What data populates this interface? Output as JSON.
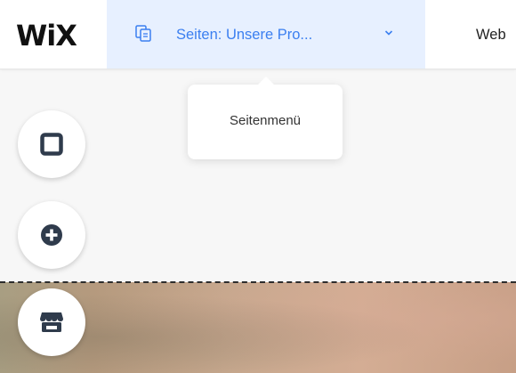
{
  "header": {
    "logo": "WiX",
    "pages_dropdown": {
      "label": "Seiten: Unsere Pro...",
      "icon": "pages-icon"
    },
    "website_label": "Web"
  },
  "tooltip": {
    "text": "Seitenmenü"
  },
  "toolbar": {
    "buttons": [
      {
        "name": "add-section-button",
        "icon": "square-icon"
      },
      {
        "name": "add-element-button",
        "icon": "plus-circle-icon"
      },
      {
        "name": "store-button",
        "icon": "store-icon"
      }
    ]
  },
  "colors": {
    "accent": "#3b7ff0",
    "dropdown_bg": "#e7f0ff",
    "icon_dark": "#2f3b4c"
  }
}
